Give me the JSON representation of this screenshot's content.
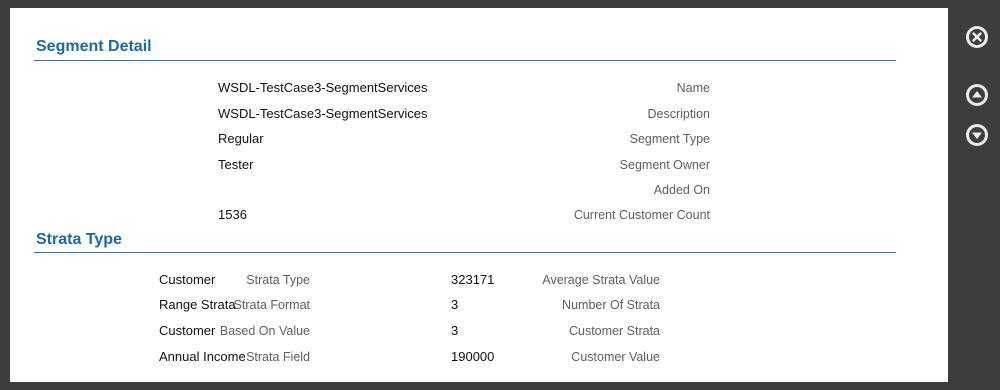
{
  "segment_detail": {
    "title": "Segment Detail",
    "fields": [
      {
        "label": "Name",
        "value": "WSDL-TestCase3-SegmentServices"
      },
      {
        "label": "Description",
        "value": "WSDL-TestCase3-SegmentServices"
      },
      {
        "label": "Segment Type",
        "value": "Regular"
      },
      {
        "label": "Segment Owner",
        "value": "Tester"
      },
      {
        "label": "Added On",
        "value": ""
      },
      {
        "label": "Current Customer Count",
        "value": "1536"
      }
    ]
  },
  "strata_type": {
    "title": "Strata Type",
    "left_fields": [
      {
        "label": "Strata Type",
        "value": "Customer"
      },
      {
        "label": "Strata Format",
        "value": "Range Strata"
      },
      {
        "label": "Based On Value",
        "value": "Customer"
      },
      {
        "label": "Strata Field",
        "value": "Annual Income"
      }
    ],
    "right_fields": [
      {
        "label": "Average Strata Value",
        "value": "323171"
      },
      {
        "label": "Number Of Strata",
        "value": "3"
      },
      {
        "label": "Customer Strata",
        "value": "3"
      },
      {
        "label": "Customer Value",
        "value": "190000"
      }
    ]
  },
  "side_controls": {
    "close_icon": "close-circle-icon",
    "up_icon": "arrow-up-circle-icon",
    "down_icon": "arrow-down-circle-icon"
  },
  "colors": {
    "accent": "#1a6aa6",
    "background": "#3d3d3d",
    "panel": "#ffffff"
  }
}
